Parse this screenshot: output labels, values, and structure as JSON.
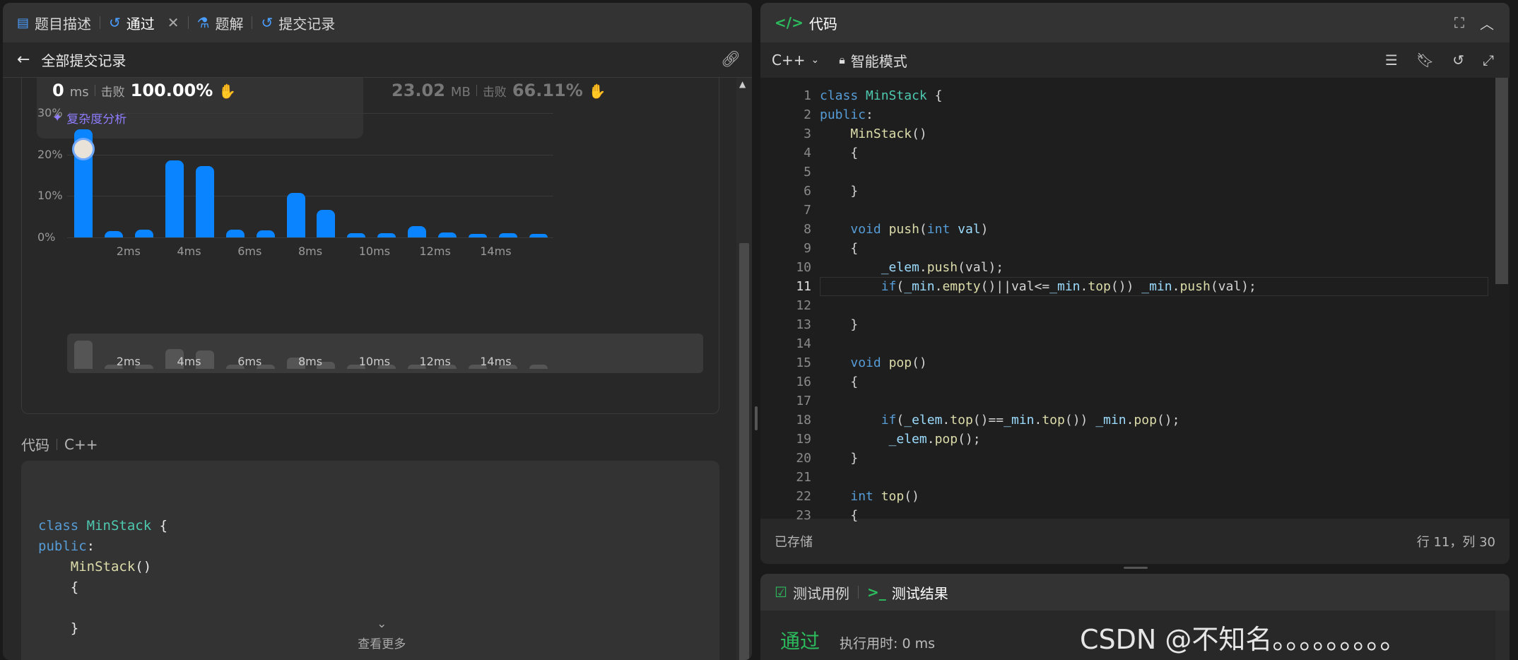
{
  "left_panel": {
    "tabs": [
      {
        "label": "题目描述"
      },
      {
        "label": "通过"
      },
      {
        "label": "题解"
      },
      {
        "label": "提交记录"
      }
    ],
    "back_label": "全部提交记录",
    "runtime": {
      "value": "0",
      "unit": "ms",
      "beat_label": "击败",
      "beat_pct": "100.00%"
    },
    "memory": {
      "value": "23.02",
      "unit": "MB",
      "beat_label": "击败",
      "beat_pct": "66.11%"
    },
    "complexity_label": "复杂度分析",
    "code_label": "代码",
    "code_lang": "C++",
    "code_preview": [
      "class MinStack {",
      "public:",
      "    MinStack()",
      "    {",
      "",
      "    }",
      "",
      "    void push(int val)"
    ],
    "see_more": "查看更多"
  },
  "chart_data": {
    "type": "bar",
    "title": "",
    "xlabel": "",
    "ylabel": "",
    "ylim": [
      0,
      30
    ],
    "yticks": [
      "30%",
      "20%",
      "10%",
      "0%"
    ],
    "xticks": [
      "2ms",
      "4ms",
      "6ms",
      "8ms",
      "10ms",
      "12ms",
      "14ms"
    ],
    "categories": [
      "0ms",
      "1ms",
      "2ms",
      "3ms",
      "4ms",
      "5ms",
      "6ms",
      "7ms",
      "8ms",
      "9ms",
      "10ms",
      "11ms",
      "12ms",
      "13ms",
      "14ms",
      "15ms"
    ],
    "values": [
      26,
      1.5,
      1.8,
      18.5,
      17.2,
      1.9,
      1.7,
      10.7,
      6.7,
      1.0,
      1.0,
      2.8,
      1.2,
      0.9,
      1.0,
      0.9
    ],
    "highlight_index": 0,
    "accent": "#0a84ff"
  },
  "right_panel": {
    "title": "代码",
    "lang": "C++",
    "mode": "智能模式",
    "status_saved": "已存储",
    "cursor_pos": "行 11，列 30",
    "line_numbers": [
      "1",
      "2",
      "3",
      "4",
      "5",
      "6",
      "7",
      "8",
      "9",
      "10",
      "11",
      "12",
      "13",
      "14",
      "15",
      "16",
      "17",
      "18",
      "19",
      "20",
      "21",
      "22",
      "23"
    ],
    "bottom_tabs": [
      {
        "label": "测试用例"
      },
      {
        "label": "测试结果"
      }
    ],
    "result_status": "通过",
    "result_time": "执行用时: 0 ms",
    "watermark": "CSDN @不知名。。。。。。。。。"
  }
}
